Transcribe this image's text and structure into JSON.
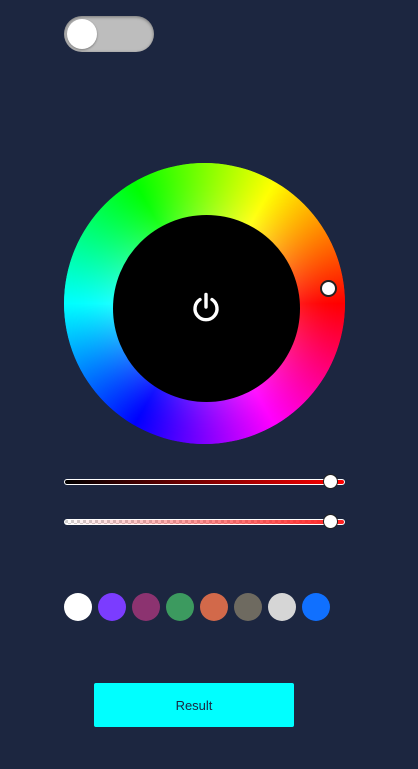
{
  "toggle": {
    "state": "off",
    "track_color": "#bdbdbd",
    "knob_color": "#ffffff"
  },
  "color_wheel": {
    "center_color": "#000000",
    "center_icon": "power-icon",
    "selected_hue_color": "#ff0000"
  },
  "sliders": [
    {
      "name": "brightness",
      "gradient_from": "#000000",
      "gradient_to": "#ff0000",
      "value_fraction": 0.95
    },
    {
      "name": "opacity",
      "gradient_from": "transparent",
      "gradient_to": "#ff2020",
      "value_fraction": 0.95
    }
  ],
  "swatches": [
    {
      "color": "#ffffff"
    },
    {
      "color": "#7b3cff"
    },
    {
      "color": "#8c3370"
    },
    {
      "color": "#3c9a5f"
    },
    {
      "color": "#d2694a"
    },
    {
      "color": "#6e6a60"
    },
    {
      "color": "#d6d6d6"
    },
    {
      "color": "#1070ff"
    }
  ],
  "result_button": {
    "label": "Result",
    "background": "#00ffff"
  },
  "colors": {
    "background": "#1c2640"
  }
}
